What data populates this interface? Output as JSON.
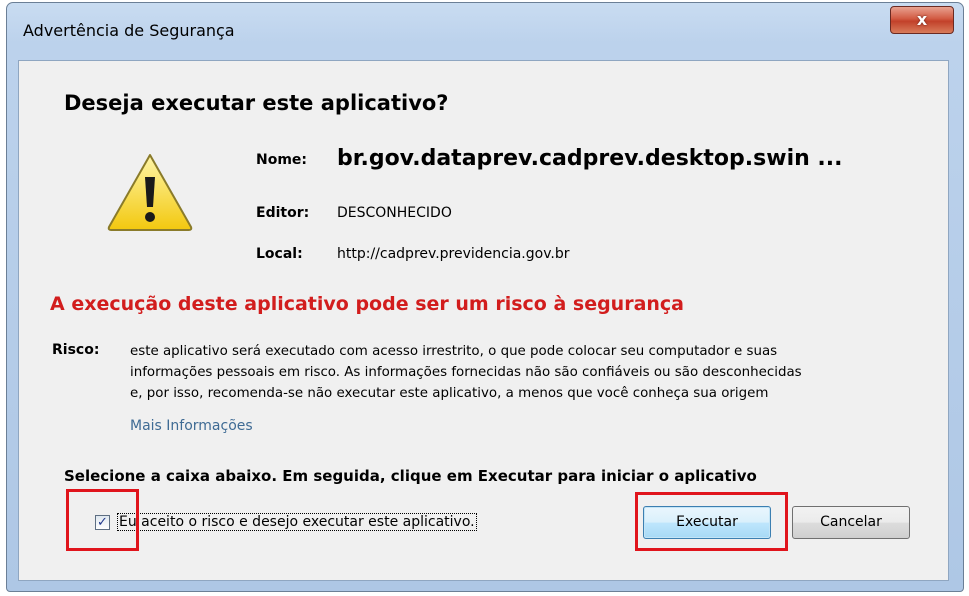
{
  "window": {
    "title": "Advertência de Segurança",
    "close_label": "x"
  },
  "dialog": {
    "heading": "Deseja executar este aplicativo?",
    "icon": "warning-icon",
    "fields": {
      "name_label": "Nome:",
      "name_value": "br.gov.dataprev.cadprev.desktop.swin ...",
      "publisher_label": "Editor:",
      "publisher_value": "DESCONHECIDO",
      "location_label": "Local:",
      "location_value": "http://cadprev.previdencia.gov.br"
    },
    "risk_heading": "A execução deste aplicativo pode ser um risco à segurança",
    "risk_label": "Risco:",
    "risk_lines": [
      "este aplicativo será executado com acesso irrestrito, o que pode colocar seu computador e suas",
      "informações pessoais em risco. As informações fornecidas não são confiáveis ou são desconhecidas",
      "e, por isso, recomenda-se não executar este aplicativo, a menos que você conheça sua origem"
    ],
    "more_info": "Mais Informações",
    "instruction": "Selecione a caixa abaixo. Em seguida, clique em Executar para iniciar o aplicativo",
    "accept_checkbox": {
      "checked": true,
      "mark": "✓",
      "label": "Eu aceito o risco e desejo executar este aplicativo."
    },
    "buttons": {
      "run": "Executar",
      "cancel": "Cancelar"
    }
  },
  "colors": {
    "risk_heading": "#d21d1d",
    "link": "#3f6b94",
    "annotation_box": "#e0141c"
  }
}
